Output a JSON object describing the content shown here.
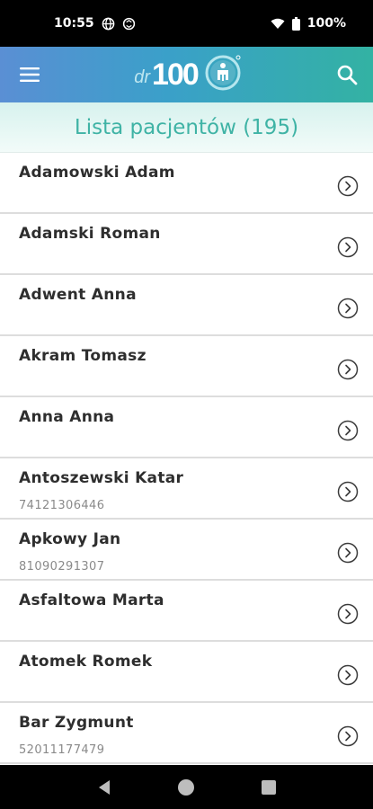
{
  "status_bar": {
    "time": "10:55",
    "battery": "100%",
    "icons": [
      "vpn-globe-icon",
      "sync-icon",
      "wifi-icon",
      "battery-icon"
    ]
  },
  "app_bar": {
    "logo_prefix": "dr",
    "logo_number": "100",
    "menu_icon": "hamburger-menu-icon",
    "search_icon": "search-icon",
    "gradient_colors": [
      "#5a8fd4",
      "#3aa0c9",
      "#33b2a3"
    ]
  },
  "list_header": {
    "title": "Lista pacjentów (195)",
    "color": "#3fb3a5"
  },
  "patients": [
    {
      "name": "Adamowski Adam",
      "pesel": ""
    },
    {
      "name": "Adamski Roman",
      "pesel": ""
    },
    {
      "name": "Adwent Anna",
      "pesel": ""
    },
    {
      "name": "Akram Tomasz",
      "pesel": ""
    },
    {
      "name": "Anna Anna",
      "pesel": ""
    },
    {
      "name": "Antoszewski Katar",
      "pesel": "74121306446"
    },
    {
      "name": "Apkowy Jan",
      "pesel": "81090291307"
    },
    {
      "name": "Asfaltowa Marta",
      "pesel": ""
    },
    {
      "name": "Atomek Romek",
      "pesel": ""
    },
    {
      "name": "Bar Zygmunt",
      "pesel": "52011177479"
    }
  ],
  "nav_bar": {
    "buttons": [
      "back-icon",
      "home-icon",
      "recents-icon"
    ]
  }
}
